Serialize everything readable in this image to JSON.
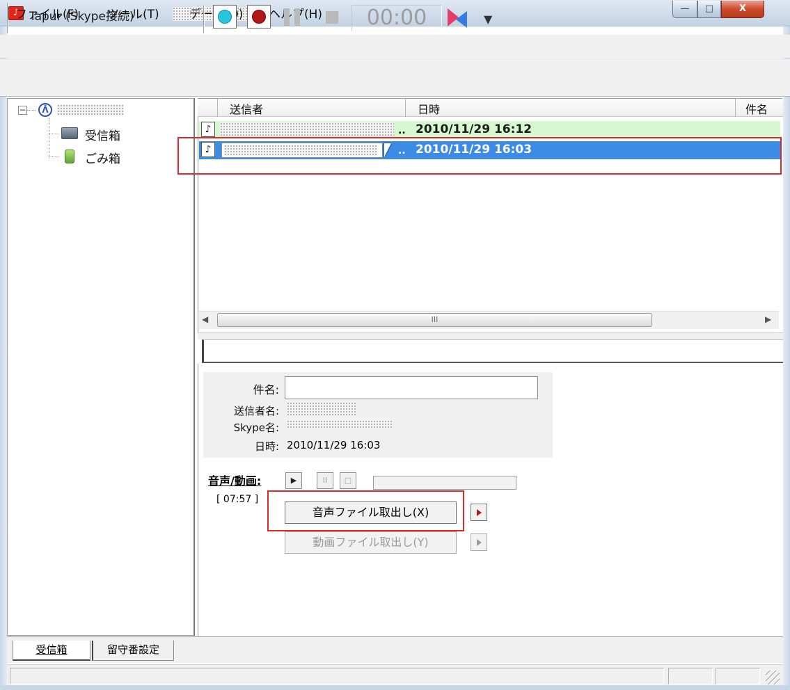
{
  "window": {
    "title": "Tapur (Skype接続) -",
    "controls": {
      "minimize": "—",
      "maximize": "□",
      "close": "X"
    }
  },
  "menu": {
    "items": [
      "ファイル(F)",
      "ツール(T)",
      "データ(D)",
      "ヘルプ(H)"
    ]
  },
  "toolbar": {
    "timer": "00:00",
    "buttons": [
      "play-circle-icon",
      "record-icon",
      "pause-icon",
      "stop-icon",
      "transfer-icon",
      "chevron-down-icon"
    ]
  },
  "tree": {
    "folders": [
      "受信箱",
      "ごみ箱"
    ]
  },
  "list": {
    "columns": [
      "送信者",
      "日時",
      "件名"
    ],
    "rows": [
      {
        "icon": "♪",
        "date": "2010/11/29 16:12",
        "state": "unread"
      },
      {
        "icon": "♪",
        "date": "2010/11/29 16:03",
        "state": "selected"
      }
    ],
    "ellipsis": "..",
    "hscroll_grip": "III"
  },
  "detail": {
    "subject_label": "件名:",
    "sender_label": "送信者名:",
    "skype_label": "Skype名:",
    "date_label": "日時:",
    "date_value": "2010/11/29 16:03",
    "subject_value": "",
    "media_label": "音声/動画:",
    "duration": "[ 07:57 ]",
    "extract_audio": "音声ファイル取出し(X)",
    "extract_video": "動画ファイル取出し(Y)",
    "media_play": "▶",
    "media_pause": "II",
    "media_stop": "□"
  },
  "tabs": [
    "受信箱",
    "留守番設定"
  ],
  "colors": {
    "selection": "#3c8ce6",
    "unread_row": "#d6f7d0",
    "annotation": "#e0282a"
  }
}
